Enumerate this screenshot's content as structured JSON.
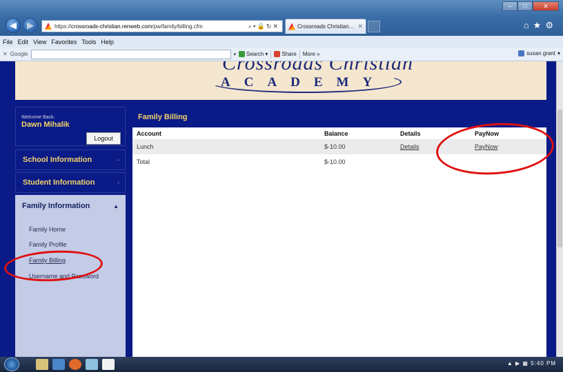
{
  "browser": {
    "url_prefix": "https://",
    "url_host": "crossroads-christian.renweb.com",
    "url_path": "/pw/family/billing.cfm",
    "tab_label": "Crossroads Christian...",
    "menu": [
      "File",
      "Edit",
      "View",
      "Favorites",
      "Tools",
      "Help"
    ],
    "google_label": "Google",
    "search_label": "Search",
    "share_label": "Share",
    "more_label": "More",
    "user_label": "susan grant"
  },
  "banner": {
    "script_text": "Crossroads Christian",
    "academy_text": "ACADEMY"
  },
  "sidebar": {
    "welcome_small": "Welcome Back:",
    "welcome_name": "Dawn Mihalik",
    "logout_label": "Logout",
    "school_info": "School Information",
    "student_info": "Student Information",
    "family_info": "Family Information",
    "family_links": [
      "Family Home",
      "Family Profile",
      "Family Billing",
      "Username and Password"
    ]
  },
  "main": {
    "title": "Family Billing",
    "columns": [
      "Account",
      "Balance",
      "Details",
      "PayNow"
    ],
    "rows": [
      {
        "account": "Lunch",
        "balance": "$-10.00",
        "details": "Details",
        "paynow": "PayNow"
      },
      {
        "account": "Total",
        "balance": "$-10.00",
        "details": "",
        "paynow": ""
      }
    ]
  },
  "taskbar": {
    "time": "5:40 PM"
  }
}
